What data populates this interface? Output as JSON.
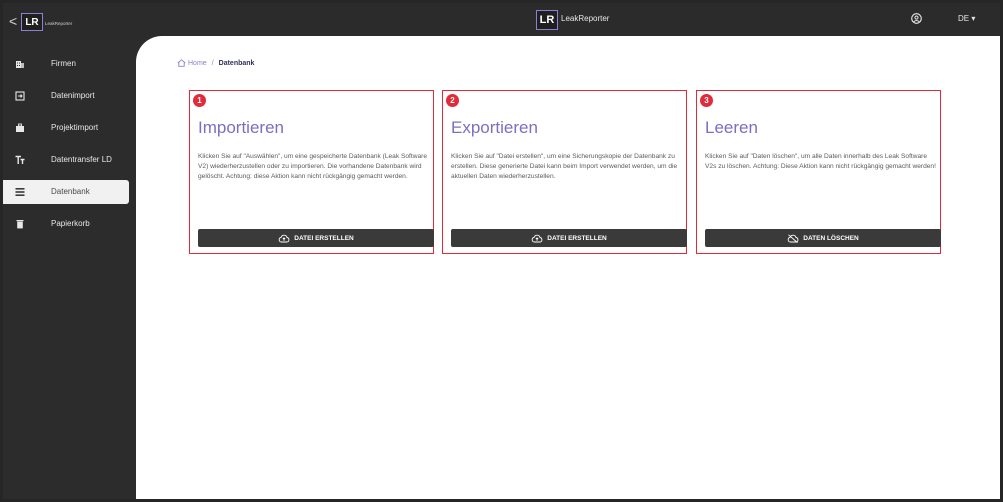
{
  "topbar": {
    "collapse_glyph": "<",
    "sidebar_logo": "LR",
    "sidebar_logo_text": "LeakReporter",
    "center_logo": "LR",
    "center_logo_text": "LeakReporter",
    "language": "DE ▾"
  },
  "sidebar": {
    "items": [
      {
        "label": "Firmen",
        "icon": "building-icon"
      },
      {
        "label": "Datenimport",
        "icon": "import-icon"
      },
      {
        "label": "Projektimport",
        "icon": "briefcase-icon"
      },
      {
        "label": "Datentransfer LD",
        "icon": "text-size-icon"
      },
      {
        "label": "Datenbank",
        "icon": "list-icon",
        "active": true
      },
      {
        "label": "Papierkorb",
        "icon": "trash-icon"
      }
    ]
  },
  "breadcrumb": {
    "home": "Home",
    "separator": "/",
    "current": "Datenbank"
  },
  "cards": [
    {
      "badge": "1",
      "title": "Importieren",
      "text": "Klicken Sie auf \"Auswählen\", um eine gespeicherte Datenbank (Leak Software V2) wiederherzustellen oder zu importieren. Die vorhandene Datenbank wird gelöscht. Achtung: diese Aktion kann nicht rückgängig gemacht werden.",
      "button": "DATEI ERSTELLEN",
      "button_icon": "cloud-upload-icon"
    },
    {
      "badge": "2",
      "title": "Exportieren",
      "text": "Klicken Sie auf \"Datei erstellen\", um eine Sicherungskopie der Datenbank zu erstellen. Diese generierte Datei kann beim Import verwendet werden, um die aktuellen Daten wiederherzustellen.",
      "button": "DATEI ERSTELLEN",
      "button_icon": "cloud-upload-icon"
    },
    {
      "badge": "3",
      "title": "Leeren",
      "text": "Klicken Sie auf \"Daten löschen\", um alle Daten innerhalb des Leak Software V2s zu löschen. Achtung: Diese Aktion kann nicht rückgängig gemacht werden!",
      "button": "DATEN LÖSCHEN",
      "button_icon": "cloud-off-icon"
    }
  ],
  "colors": {
    "accent": "#7a6fc4",
    "highlight": "#e02b3a",
    "sidebar_bg": "#2c2c2c",
    "button_bg": "#3a3a3a"
  }
}
